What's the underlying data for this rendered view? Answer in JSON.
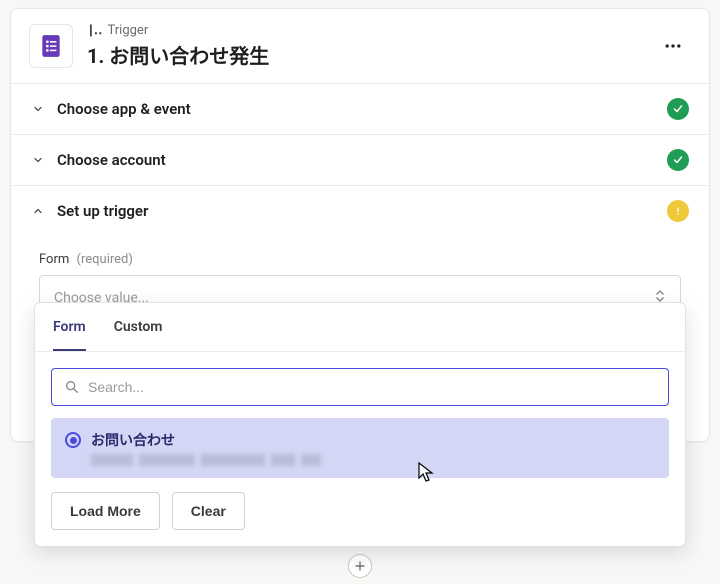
{
  "header": {
    "type_label": "Trigger",
    "title": "1. お問い合わせ発生"
  },
  "sections": {
    "choose_app": "Choose app & event",
    "choose_account": "Choose account",
    "setup_trigger": "Set up trigger"
  },
  "field": {
    "label": "Form",
    "required": "(required)",
    "placeholder": "Choose value..."
  },
  "dropdown": {
    "tabs": {
      "form": "Form",
      "custom": "Custom"
    },
    "search_placeholder": "Search...",
    "option": {
      "title": "お問い合わせ"
    },
    "load_more": "Load More",
    "clear": "Clear"
  },
  "icons": {
    "app": "google-forms-icon",
    "more": "more-icon",
    "check": "check-icon",
    "warn": "exclamation-icon",
    "chevron_down": "chevron-down-icon",
    "chevron_up": "chevron-up-icon",
    "updown": "sort-updown-icon",
    "search": "search-icon",
    "plus": "plus-icon",
    "cursor": "cursor-icon"
  }
}
